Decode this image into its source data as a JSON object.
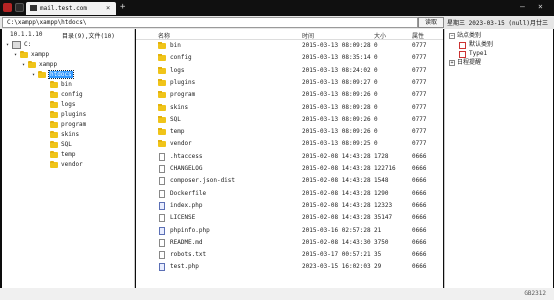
{
  "tab": {
    "title": "mail.test.com",
    "close": "×"
  },
  "window": {
    "new_tab": "+",
    "minimize": "—",
    "close": "×"
  },
  "address_bar": {
    "value": "C:\\xampp\\xampp\\htdocs\\",
    "read_label": "读取",
    "date": "星期三 2023-03-15 (null)月廿三"
  },
  "left_panel": {
    "ip": "10.1.1.10",
    "summary": "目录(9),文件(10)",
    "tree": [
      {
        "label": "C:",
        "type": "drive",
        "exp": "▾"
      },
      {
        "label": "xampp",
        "type": "folder",
        "exp": "▾"
      },
      {
        "label": "xampp",
        "type": "folder",
        "exp": "▾"
      },
      {
        "label": "htdocs",
        "type": "folder",
        "exp": "▾",
        "selected": true
      },
      {
        "label": "bin",
        "type": "folder"
      },
      {
        "label": "config",
        "type": "folder"
      },
      {
        "label": "logs",
        "type": "folder"
      },
      {
        "label": "plugins",
        "type": "folder"
      },
      {
        "label": "program",
        "type": "folder"
      },
      {
        "label": "skins",
        "type": "folder"
      },
      {
        "label": "SQL",
        "type": "folder"
      },
      {
        "label": "temp",
        "type": "folder"
      },
      {
        "label": "vendor",
        "type": "folder"
      }
    ]
  },
  "file_list": {
    "headers": {
      "name": "名称",
      "time": "时间",
      "size": "大小",
      "attr": "属性"
    },
    "rows": [
      {
        "icon": "folder",
        "name": "bin",
        "time": "2015-03-13 08:09:28",
        "size": "0",
        "attr": "0777"
      },
      {
        "icon": "folder",
        "name": "config",
        "time": "2015-03-13 08:35:14",
        "size": "0",
        "attr": "0777"
      },
      {
        "icon": "folder",
        "name": "logs",
        "time": "2015-03-13 08:24:02",
        "size": "0",
        "attr": "0777"
      },
      {
        "icon": "folder",
        "name": "plugins",
        "time": "2015-03-13 08:09:27",
        "size": "0",
        "attr": "0777"
      },
      {
        "icon": "folder",
        "name": "program",
        "time": "2015-03-13 08:09:26",
        "size": "0",
        "attr": "0777"
      },
      {
        "icon": "folder",
        "name": "skins",
        "time": "2015-03-13 08:09:28",
        "size": "0",
        "attr": "0777"
      },
      {
        "icon": "folder",
        "name": "SQL",
        "time": "2015-03-13 08:09:26",
        "size": "0",
        "attr": "0777"
      },
      {
        "icon": "folder",
        "name": "temp",
        "time": "2015-03-13 08:09:26",
        "size": "0",
        "attr": "0777"
      },
      {
        "icon": "folder",
        "name": "vendor",
        "time": "2015-03-13 08:09:25",
        "size": "0",
        "attr": "0777"
      },
      {
        "icon": "file",
        "name": ".htaccess",
        "time": "2015-02-08 14:43:28",
        "size": "1728",
        "attr": "0666"
      },
      {
        "icon": "file",
        "name": "CHANGELOG",
        "time": "2015-02-08 14:43:28",
        "size": "122716",
        "attr": "0666"
      },
      {
        "icon": "file",
        "name": "composer.json-dist",
        "time": "2015-02-08 14:43:28",
        "size": "1548",
        "attr": "0666"
      },
      {
        "icon": "file",
        "name": "Dockerfile",
        "time": "2015-02-08 14:43:28",
        "size": "1290",
        "attr": "0666"
      },
      {
        "icon": "php",
        "name": "index.php",
        "time": "2015-02-08 14:43:28",
        "size": "12323",
        "attr": "0666"
      },
      {
        "icon": "file",
        "name": "LICENSE",
        "time": "2015-02-08 14:43:28",
        "size": "35147",
        "attr": "0666"
      },
      {
        "icon": "php",
        "name": "phpinfo.php",
        "time": "2015-03-16 02:57:28",
        "size": "21",
        "attr": "0666"
      },
      {
        "icon": "file",
        "name": "README.md",
        "time": "2015-02-08 14:43:30",
        "size": "3750",
        "attr": "0666"
      },
      {
        "icon": "file",
        "name": "robots.txt",
        "time": "2015-03-17 00:57:21",
        "size": "35",
        "attr": "0666"
      },
      {
        "icon": "php",
        "name": "test.php",
        "time": "2023-03-15 16:02:03",
        "size": "29",
        "attr": "0666"
      }
    ]
  },
  "right_panel": {
    "items": [
      {
        "label": "站点类别",
        "level": 0,
        "exp": "−"
      },
      {
        "label": "默认类别",
        "level": 1
      },
      {
        "label": "Type1",
        "level": 1
      },
      {
        "label": "日程提醒",
        "level": 0,
        "exp": "+"
      }
    ]
  },
  "status_bar": {
    "text": "GB2312"
  },
  "colors": {
    "selection": "#3399ff",
    "folder": "#f0c419",
    "chrome": "#0d0d0d"
  }
}
